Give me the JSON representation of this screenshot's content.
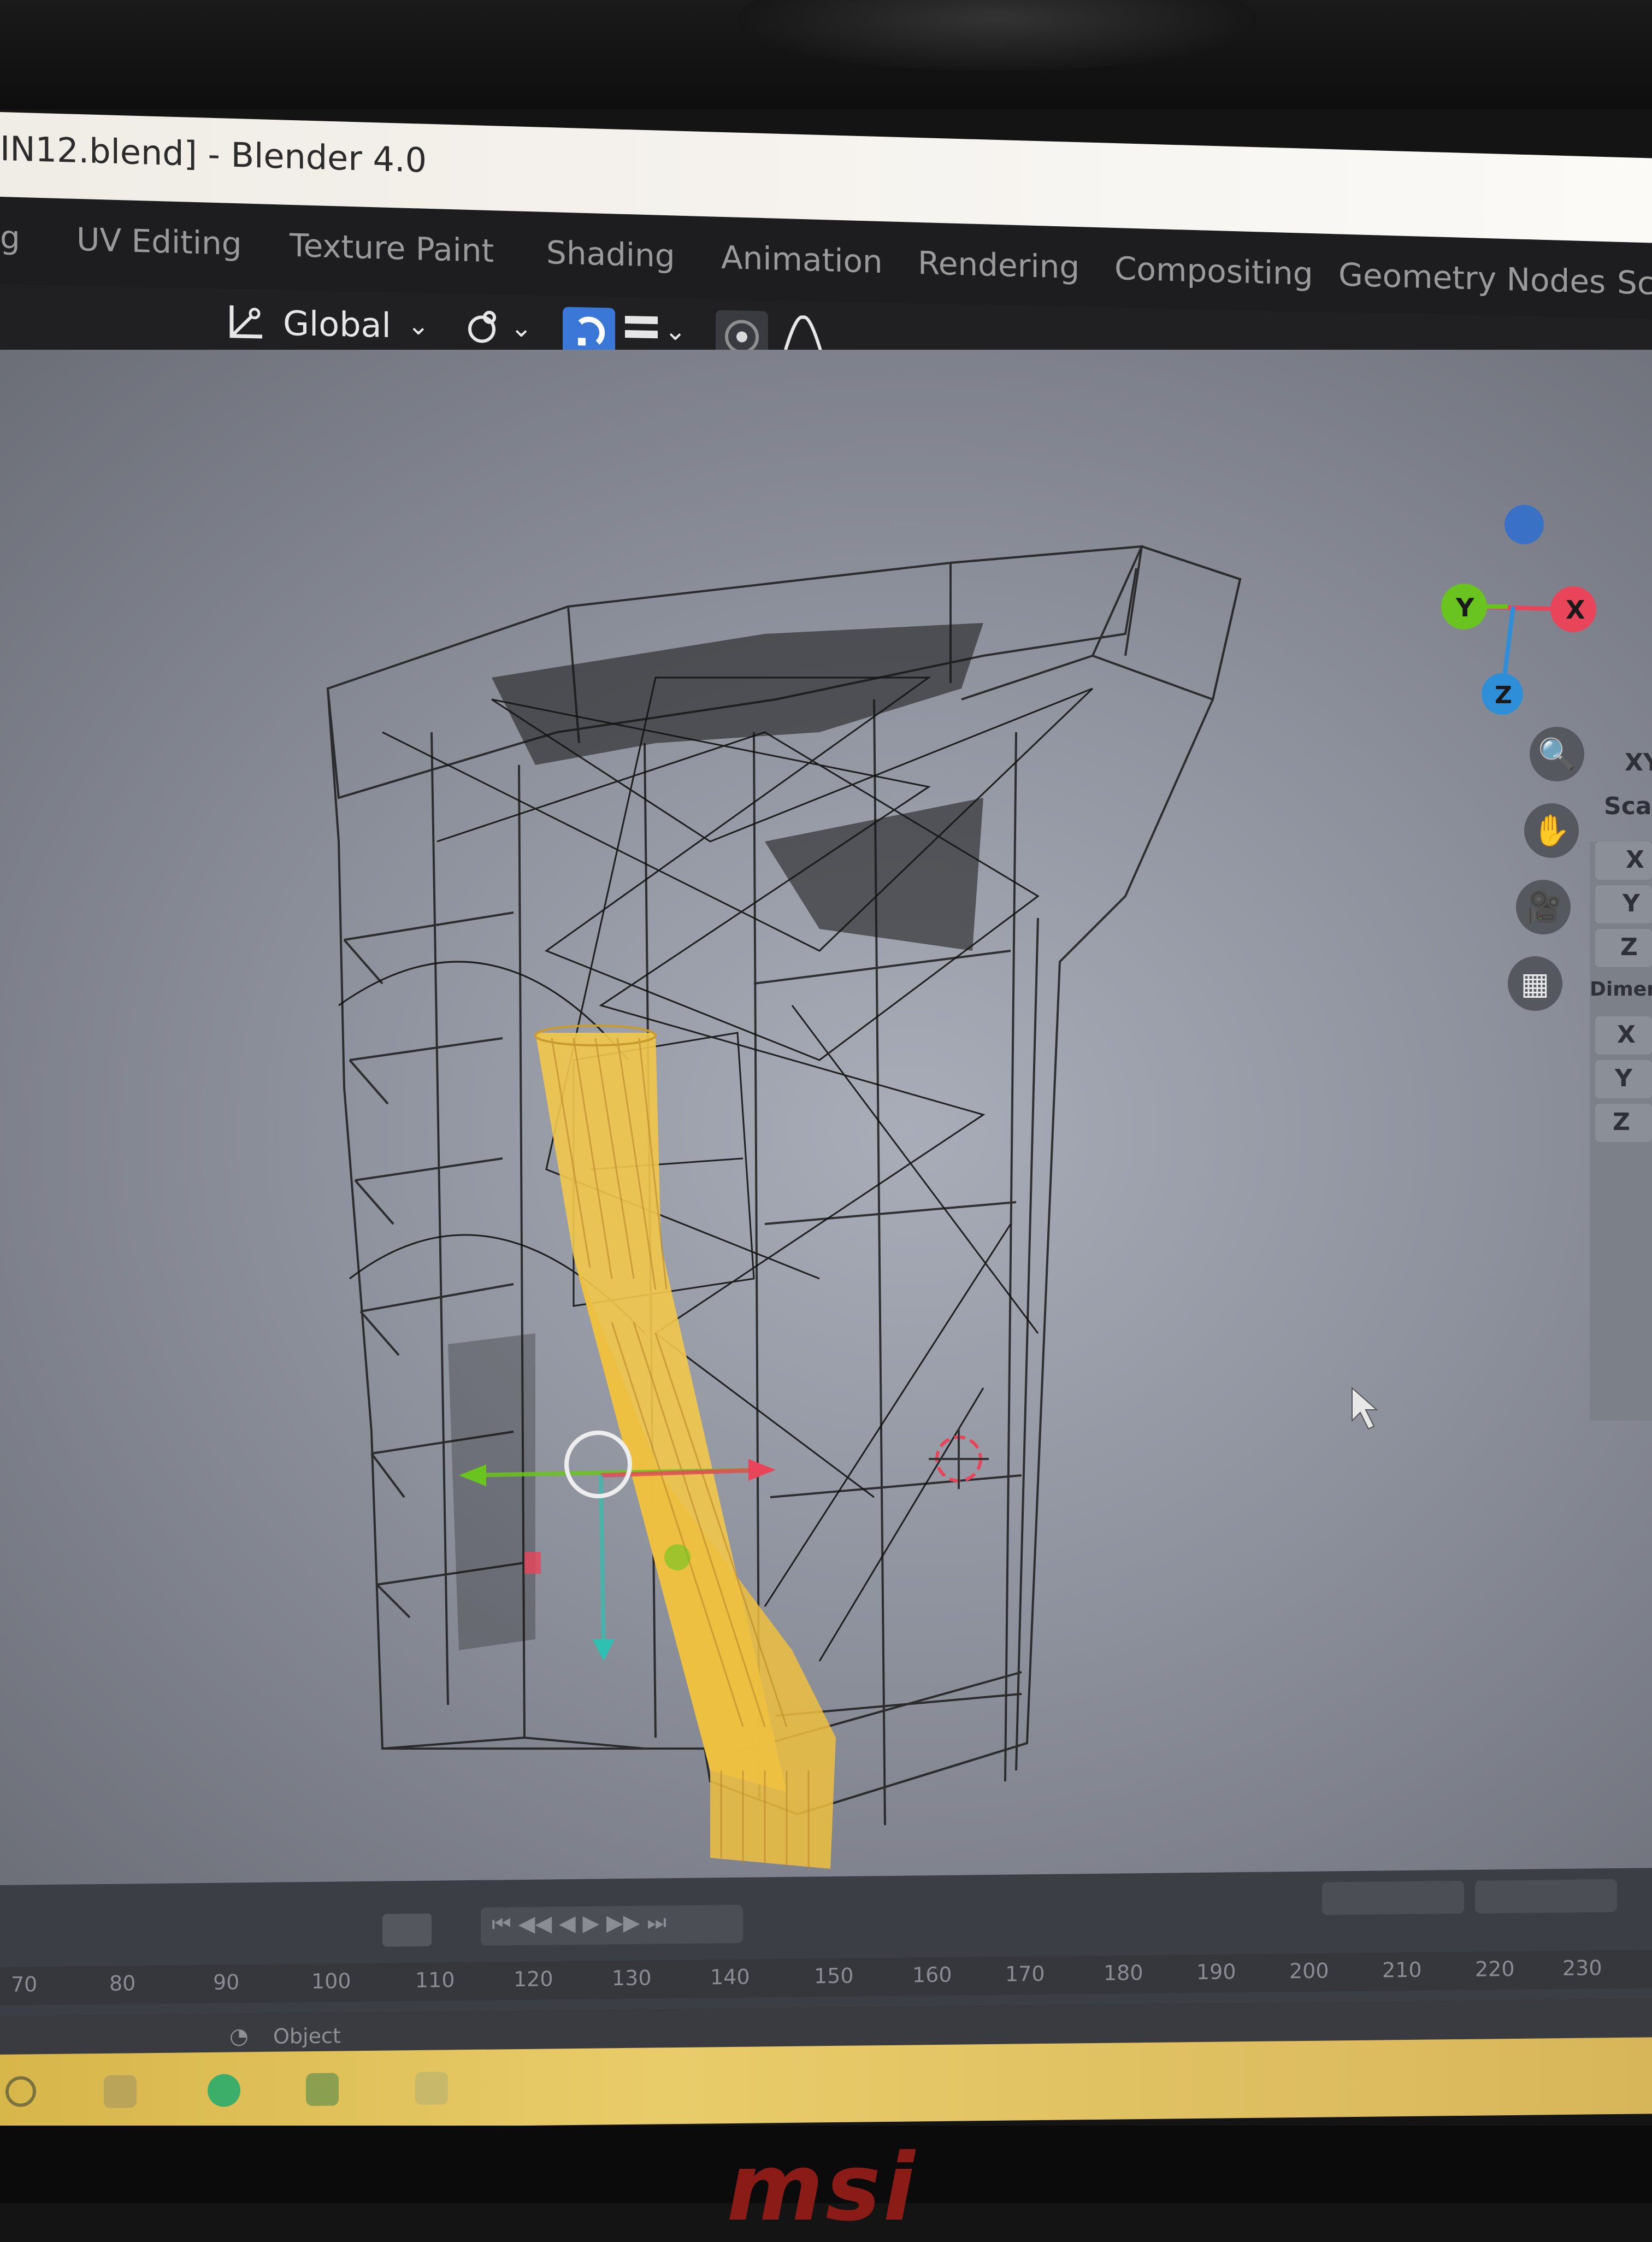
{
  "window": {
    "title": "IN12.blend] - Blender 4.0"
  },
  "workspace_tabs": [
    {
      "label": "g"
    },
    {
      "label": "UV Editing"
    },
    {
      "label": "Texture Paint"
    },
    {
      "label": "Shading"
    },
    {
      "label": "Animation"
    },
    {
      "label": "Rendering"
    },
    {
      "label": "Compositing"
    },
    {
      "label": "Geometry Nodes"
    },
    {
      "label": "Sc"
    }
  ],
  "header": {
    "transform_orientation": "Global",
    "icons": [
      "transform-orientation-icon",
      "pivot-icon",
      "snap-magnet-icon",
      "snap-increment-icon",
      "proportional-edit-icon",
      "falloff-icon",
      "visibility-icon"
    ]
  },
  "viewport": {
    "gizmo_axes": {
      "x": "X",
      "y": "Y",
      "z": "Z"
    },
    "nav_buttons": [
      "zoom-icon",
      "pan-hand-icon",
      "camera-icon",
      "grid-ortho-icon"
    ],
    "colors": {
      "selected_object": "#f2c84b",
      "wire": "#1c1c1c",
      "axis_x": "#e8455a",
      "axis_y": "#6ac41f",
      "axis_z": "#2e8fd8"
    }
  },
  "n_panel": {
    "labels": [
      "XY",
      "Sca",
      "X",
      "Y",
      "Z",
      "Dimen",
      "X",
      "Y",
      "Z"
    ]
  },
  "timeline": {
    "ticks": [
      "70",
      "80",
      "90",
      "100",
      "110",
      "120",
      "130",
      "140",
      "150",
      "160",
      "170",
      "180",
      "190",
      "200",
      "210",
      "220",
      "230"
    ]
  },
  "status": {
    "mode": "Object"
  },
  "brand": "msi"
}
